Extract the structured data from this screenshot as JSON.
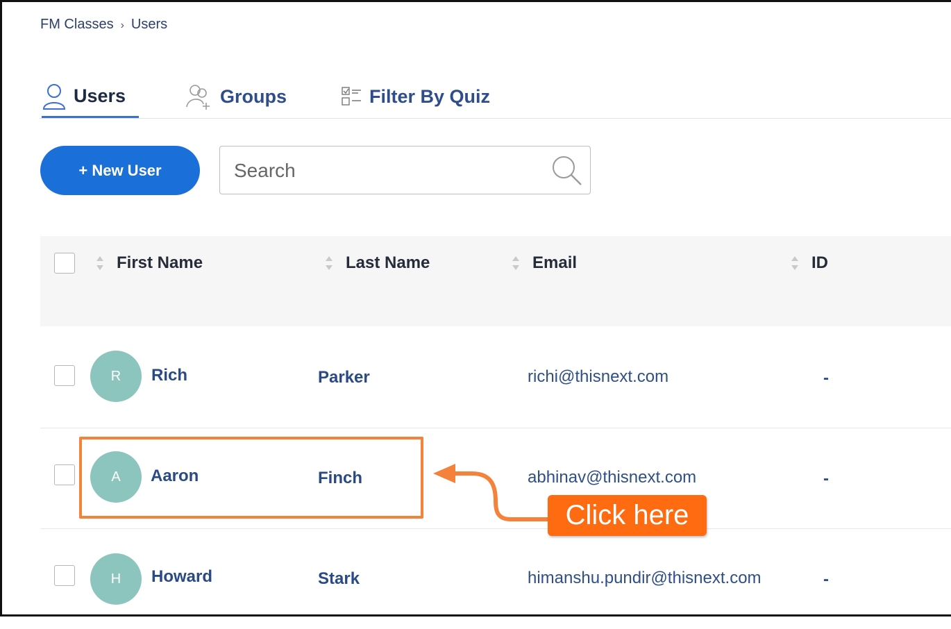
{
  "breadcrumb": {
    "parent": "FM Classes",
    "separator": "›",
    "current": "Users"
  },
  "tabs": [
    {
      "label": "Users",
      "icon": "user-icon",
      "active": true
    },
    {
      "label": "Groups",
      "icon": "group-add-icon",
      "active": false
    },
    {
      "label": "Filter By Quiz",
      "icon": "checklist-icon",
      "active": false
    }
  ],
  "toolbar": {
    "new_user_label": "+ New User",
    "search_placeholder": "Search"
  },
  "table": {
    "columns": [
      "First Name",
      "Last Name",
      "Email",
      "ID"
    ],
    "rows": [
      {
        "initial": "R",
        "first_name": "Rich",
        "last_name": "Parker",
        "email": "richi@thisnext.com",
        "id": "-"
      },
      {
        "initial": "A",
        "first_name": "Aaron",
        "last_name": "Finch",
        "email": "abhinav@thisnext.com",
        "id": "-"
      },
      {
        "initial": "H",
        "first_name": "Howard",
        "last_name": "Stark",
        "email": "himanshu.pundir@thisnext.com",
        "id": "-"
      }
    ]
  },
  "annotation": {
    "callout_text": "Click here",
    "color": "#f4823b"
  },
  "colors": {
    "primary": "#1a6fd8",
    "link": "#2a4a86",
    "avatar": "#8cc5bd"
  }
}
